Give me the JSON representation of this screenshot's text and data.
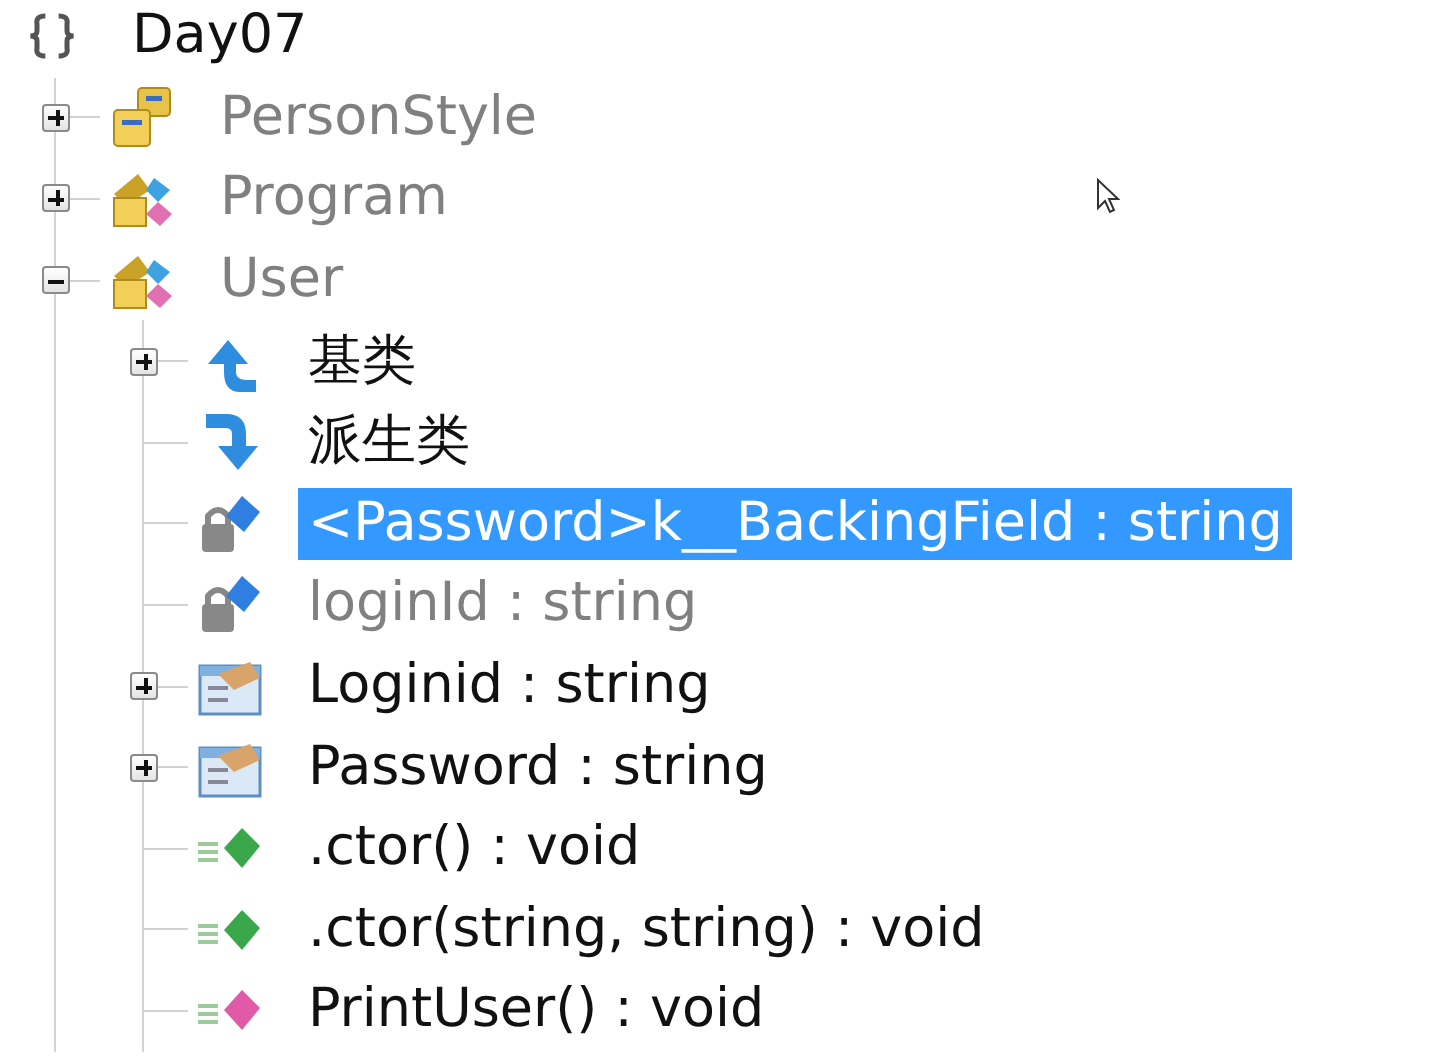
{
  "tree": {
    "label": "Day07",
    "kind": "namespace",
    "children": [
      {
        "label": "PersonStyle",
        "kind": "enum",
        "expanded": false,
        "muted": true,
        "selected": false
      },
      {
        "label": "Program",
        "kind": "class",
        "expanded": false,
        "muted": true,
        "selected": false
      },
      {
        "label": "User",
        "kind": "class",
        "expanded": true,
        "muted": true,
        "selected": false,
        "children": [
          {
            "label": "基类",
            "kind": "base-types",
            "expanded": false,
            "muted": false,
            "selected": false
          },
          {
            "label": "派生类",
            "kind": "derived-types",
            "muted": false,
            "selected": false
          },
          {
            "label": "<Password>k__BackingField : string",
            "kind": "field",
            "muted": false,
            "selected": true
          },
          {
            "label": "loginId : string",
            "kind": "field",
            "muted": true,
            "selected": false
          },
          {
            "label": "Loginid : string",
            "kind": "property",
            "expanded": false,
            "muted": false,
            "selected": false
          },
          {
            "label": "Password : string",
            "kind": "property",
            "expanded": false,
            "muted": false,
            "selected": false
          },
          {
            "label": ".ctor() : void",
            "kind": "ctor",
            "muted": false,
            "selected": false
          },
          {
            "label": ".ctor(string, string) : void",
            "kind": "ctor",
            "muted": false,
            "selected": false
          },
          {
            "label": "PrintUser() : void",
            "kind": "method",
            "muted": false,
            "selected": false
          }
        ]
      }
    ]
  }
}
